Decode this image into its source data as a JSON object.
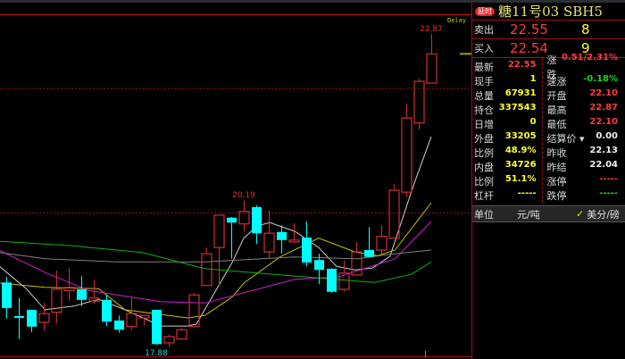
{
  "header": {
    "badge": "延时",
    "title": "糖11号03  SBH5",
    "delay_label": "Delay"
  },
  "quote": {
    "sell": {
      "label": "卖出",
      "price": "22.55",
      "volume": "8"
    },
    "buy": {
      "label": "买入",
      "price": "22.54",
      "volume": "9"
    }
  },
  "info": [
    {
      "k1": "最新",
      "v1": "22.55",
      "c1": "red",
      "k2": "涨跌",
      "v2": "0.51/2.31%",
      "c2": "red"
    },
    {
      "k1": "现手",
      "v1": "1",
      "c1": "yel",
      "k2": "速涨",
      "v2": "-0.18%",
      "c2": "grn"
    },
    {
      "k1": "总量",
      "v1": "67931",
      "c1": "yel",
      "k2": "开盘",
      "v2": "22.10",
      "c2": "red"
    },
    {
      "k1": "持仓",
      "v1": "337543",
      "c1": "yel",
      "k2": "最高",
      "v2": "22.87",
      "c2": "red"
    },
    {
      "k1": "日增",
      "v1": "0",
      "c1": "yel",
      "k2": "最低",
      "v2": "22.10",
      "c2": "red"
    },
    {
      "k1": "外盘",
      "v1": "33205",
      "c1": "yel",
      "k2": "结算价 ▾",
      "v2": "0.00",
      "c2": "wht"
    },
    {
      "k1": "比例",
      "v1": "48.9%",
      "c1": "yel",
      "k2": "昨收",
      "v2": "22.13",
      "c2": "wht"
    },
    {
      "k1": "内盘",
      "v1": "34726",
      "c1": "yel",
      "k2": "昨结",
      "v2": "22.04",
      "c2": "wht"
    },
    {
      "k1": "比例",
      "v1": "51.1%",
      "c1": "yel",
      "k2": "涨停",
      "v2": "-----",
      "c2": "red"
    },
    {
      "k1": "杠杆",
      "v1": "-----",
      "c1": "yel",
      "k2": "跌停",
      "v2": "-----",
      "c2": "grn"
    }
  ],
  "unit": {
    "label": "单位",
    "value": "元/吨",
    "check": "✓",
    "alt": "美分/磅"
  },
  "colors": {
    "up": "#d03030",
    "down": "#00ffff",
    "ma1": "#d0d0d0",
    "ma2": "#c8c000",
    "ma3": "#d020d0",
    "ma4": "#808080",
    "ma5": "#10b010",
    "grid": "#a01010"
  },
  "chart_data": {
    "type": "candlestick",
    "ylim": [
      17.84,
      22.87
    ],
    "reference_lines": [
      22.0,
      20.0
    ],
    "annotations": {
      "high": "22.87",
      "mid_high": "20.19",
      "low": "17.88"
    },
    "last_price": 22.55,
    "candles": [
      [
        18.88,
        18.97,
        18.3,
        18.47
      ],
      [
        18.34,
        18.63,
        17.97,
        18.33
      ],
      [
        18.44,
        18.44,
        18.08,
        18.17
      ],
      [
        18.24,
        18.55,
        18.11,
        18.38
      ],
      [
        18.4,
        19.07,
        18.22,
        18.77
      ],
      [
        18.75,
        19.11,
        18.58,
        18.8
      ],
      [
        18.77,
        18.98,
        18.5,
        18.6
      ],
      [
        18.58,
        18.91,
        18.54,
        18.63
      ],
      [
        18.6,
        18.68,
        18.18,
        18.25
      ],
      [
        18.27,
        18.35,
        18.07,
        18.12
      ],
      [
        18.17,
        18.64,
        18.12,
        18.38
      ],
      [
        18.31,
        18.35,
        18.18,
        18.35
      ],
      [
        18.44,
        18.44,
        17.88,
        17.89
      ],
      [
        17.91,
        18.04,
        17.84,
        18.01
      ],
      [
        17.97,
        18.15,
        17.97,
        18.12
      ],
      [
        18.17,
        18.71,
        18.17,
        18.68
      ],
      [
        18.83,
        19.44,
        18.83,
        19.34
      ],
      [
        19.44,
        19.96,
        18.83,
        19.96
      ],
      [
        19.92,
        19.93,
        19.26,
        19.84
      ],
      [
        19.82,
        20.19,
        19.7,
        20.02
      ],
      [
        20.09,
        20.12,
        19.5,
        19.67
      ],
      [
        19.37,
        20.03,
        19.26,
        19.67
      ],
      [
        19.69,
        19.8,
        19.34,
        19.56
      ],
      [
        19.53,
        19.83,
        19.51,
        19.56
      ],
      [
        19.6,
        19.86,
        19.14,
        19.2
      ],
      [
        19.24,
        19.34,
        18.85,
        19.08
      ],
      [
        19.1,
        19.11,
        18.71,
        18.73
      ],
      [
        18.77,
        19.23,
        18.73,
        19.03
      ],
      [
        19.0,
        19.53,
        19.0,
        19.37
      ],
      [
        19.4,
        19.77,
        19.29,
        19.29
      ],
      [
        19.4,
        19.8,
        19.33,
        19.62
      ],
      [
        19.59,
        20.46,
        19.59,
        20.36
      ],
      [
        20.33,
        21.75,
        20.25,
        21.52
      ],
      [
        21.44,
        22.15,
        21.34,
        22.11
      ],
      [
        22.08,
        22.87,
        22.08,
        22.55
      ]
    ],
    "ma_lines": [
      {
        "color": "ma1",
        "points": [
          [
            0.5,
            19.13
          ],
          [
            2.6,
            18.78
          ],
          [
            4.1,
            18.44
          ],
          [
            6.4,
            18.5
          ],
          [
            8.4,
            18.61
          ],
          [
            10.5,
            18.44
          ],
          [
            13.4,
            18.18
          ],
          [
            15.5,
            18.18
          ],
          [
            16.2,
            18.21
          ],
          [
            19.1,
            19.21
          ],
          [
            20,
            19.59
          ],
          [
            21.1,
            19.79
          ],
          [
            22.1,
            19.84
          ],
          [
            24.1,
            19.7
          ],
          [
            26,
            19.44
          ],
          [
            27.4,
            19.14
          ],
          [
            28.9,
            19.08
          ],
          [
            30.3,
            19.11
          ],
          [
            31.7,
            19.3
          ],
          [
            33.6,
            20.45
          ],
          [
            35,
            21.22
          ]
        ]
      },
      {
        "color": "ma2",
        "points": [
          [
            0.5,
            18.87
          ],
          [
            4.1,
            18.8
          ],
          [
            8.4,
            18.78
          ],
          [
            10.5,
            18.44
          ],
          [
            15.5,
            18.31
          ],
          [
            16.9,
            18.35
          ],
          [
            19.1,
            18.65
          ],
          [
            20,
            18.87
          ],
          [
            22.9,
            19.29
          ],
          [
            26,
            19.59
          ],
          [
            28.9,
            19.37
          ],
          [
            30.7,
            19.31
          ],
          [
            32.1,
            19.4
          ],
          [
            35,
            20.16
          ]
        ]
      },
      {
        "color": "ma3",
        "points": [
          [
            0.5,
            19.39
          ],
          [
            4.1,
            19.04
          ],
          [
            7.6,
            18.75
          ],
          [
            13.4,
            18.57
          ],
          [
            16.9,
            18.55
          ],
          [
            24.1,
            18.93
          ],
          [
            27.6,
            18.97
          ],
          [
            32.1,
            19.26
          ],
          [
            35,
            19.86
          ]
        ]
      },
      {
        "color": "ma4",
        "points": [
          [
            0.5,
            19.36
          ],
          [
            4.1,
            19.26
          ],
          [
            9.8,
            19.21
          ],
          [
            16.9,
            19.21
          ],
          [
            24.1,
            19.29
          ],
          [
            29.1,
            19.26
          ],
          [
            31.6,
            19.33
          ],
          [
            35,
            19.4
          ]
        ]
      },
      {
        "color": "ma5",
        "points": [
          [
            0.5,
            19.54
          ],
          [
            6.2,
            19.47
          ],
          [
            11.9,
            19.36
          ],
          [
            16.9,
            19.1
          ],
          [
            29.1,
            18.9
          ],
          [
            30.5,
            18.88
          ],
          [
            33.4,
            19.01
          ],
          [
            35,
            19.21
          ]
        ]
      }
    ]
  }
}
